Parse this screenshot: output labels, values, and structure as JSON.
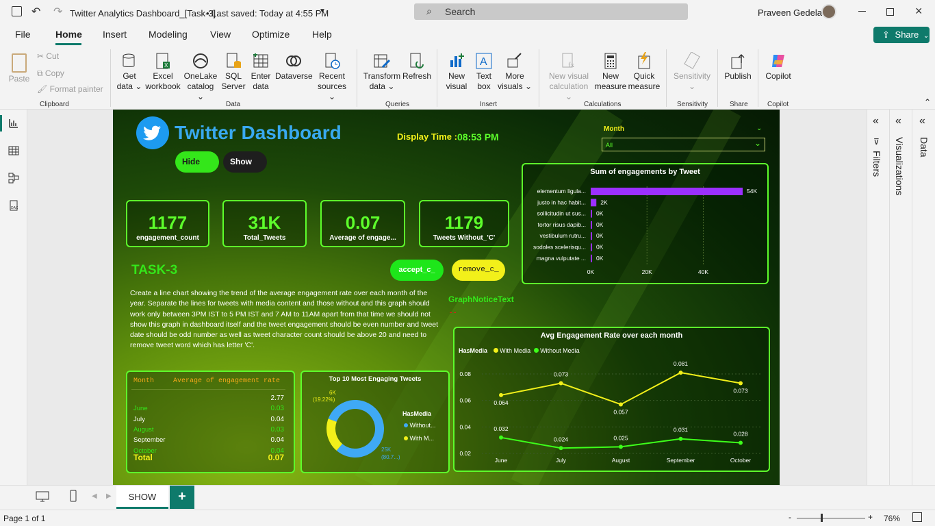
{
  "title_bar": {
    "title": "Twitter Analytics Dashboard_[Task-3]",
    "saved": "• Last saved: Today at 4:55 PM",
    "search_placeholder": "Search",
    "user": "Praveen Gedela"
  },
  "tabs": [
    "File",
    "Home",
    "Insert",
    "Modeling",
    "View",
    "Optimize",
    "Help"
  ],
  "share_label": "Share",
  "ribbon": {
    "paste": "Paste",
    "cut": "Cut",
    "copy": "Copy",
    "format_painter": "Format painter",
    "clipboard": "Clipboard",
    "get_data": [
      "Get",
      "data ⌄"
    ],
    "excel": [
      "Excel",
      "workbook"
    ],
    "onelake": [
      "OneLake",
      "catalog ⌄"
    ],
    "sql": [
      "SQL",
      "Server"
    ],
    "enter": [
      "Enter",
      "data"
    ],
    "dataverse": "Dataverse",
    "recent": [
      "Recent",
      "sources ⌄"
    ],
    "data_group": "Data",
    "transform": [
      "Transform",
      "data ⌄"
    ],
    "refresh": "Refresh",
    "queries": "Queries",
    "new_visual": [
      "New",
      "visual"
    ],
    "text_box": [
      "Text",
      "box"
    ],
    "more_visuals": [
      "More",
      "visuals ⌄"
    ],
    "insert": "Insert",
    "new_visual_calc": [
      "New visual",
      "calculation ⌄"
    ],
    "new_measure": [
      "New",
      "measure"
    ],
    "quick_measure": [
      "Quick",
      "measure"
    ],
    "calculations": "Calculations",
    "sensitivity": [
      "Sensitivity",
      "⌄"
    ],
    "sensitivity_group": "Sensitivity",
    "publish": "Publish",
    "share_group": "Share",
    "copilot": "Copilot",
    "copilot_group": "Copilot"
  },
  "dashboard": {
    "title": "Twitter Dashboard",
    "display_time_label": "Display Time :",
    "display_time": "08:53 PM",
    "hide": "Hide",
    "show": "Show",
    "month_label": "Month",
    "month_value": "All",
    "kpis": [
      {
        "value": "1177",
        "label": "engagement_count"
      },
      {
        "value": "31K",
        "label": "Total_Tweets"
      },
      {
        "value": "0.07",
        "label": "Average of engage..."
      },
      {
        "value": "1179",
        "label": "Tweets Without_'C'"
      }
    ],
    "task": "TASK-3",
    "accept": "accept_c_",
    "remove": "remove_c_",
    "description": "Create a line chart showing the trend of the average engagement rate over each month of the year. Separate the lines for tweets with media content and those without and this graph should work only between 3PM IST to 5 PM IST and 7 AM to 11AM apart from that time we should not show this graph in dashboard itself and the tweet engagement should be even number and tweet date should be odd number as well as tweet character count should be above 20 and need to remove tweet word which has letter 'C'.",
    "notice": "GraphNoticeText",
    "notice_dash": "- -",
    "table": {
      "headers": [
        "Month",
        "Average of engagement rate"
      ],
      "rows": [
        [
          "",
          "2.77"
        ],
        [
          "June",
          "0.03"
        ],
        [
          "July",
          "0.04"
        ],
        [
          "August",
          "0.03"
        ],
        [
          "September",
          "0.04"
        ],
        [
          "October",
          "0.04"
        ]
      ],
      "total_label": "Total",
      "total_value": "0.07"
    },
    "donut": {
      "title": "Top 10 Most Engaging Tweets",
      "legend_title": "HasMedia",
      "legend": [
        "Without...",
        "With M..."
      ],
      "label_small": "6K",
      "label_small_pct": "(19.22%)",
      "label_big": "25K",
      "label_big_pct": "(80.7...)"
    }
  },
  "chart_data": [
    {
      "type": "bar",
      "title": "Sum of engagements by Tweet",
      "orientation": "horizontal",
      "categories": [
        "elementum ligula...",
        "justo in hac habit...",
        "sollicitudin ut sus...",
        "tortor risus dapib...",
        "vestibulum rutru...",
        "sodales scelerisqu...",
        "magna vulputate ..."
      ],
      "values": [
        54000,
        2000,
        0,
        0,
        0,
        0,
        0
      ],
      "data_labels": [
        "54K",
        "2K",
        "0K",
        "0K",
        "0K",
        "0K",
        "0K"
      ],
      "xticks": [
        "0K",
        "20K",
        "40K"
      ],
      "xlim": [
        0,
        54000
      ],
      "color": "#9b30ff"
    },
    {
      "type": "line",
      "title": "Avg Engagement Rate over each month",
      "legend_title": "HasMedia",
      "categories": [
        "June",
        "July",
        "August",
        "September",
        "October"
      ],
      "series": [
        {
          "name": "With Media",
          "values": [
            0.064,
            0.073,
            0.057,
            0.081,
            0.073
          ],
          "color": "#f2f01a"
        },
        {
          "name": "Without Media",
          "values": [
            0.032,
            0.024,
            0.025,
            0.031,
            0.028
          ],
          "color": "#3dff1a"
        }
      ],
      "yticks": [
        "0.08",
        "0.06",
        "0.04",
        "0.02"
      ],
      "ylim": [
        0.02,
        0.08
      ]
    },
    {
      "type": "pie",
      "title": "Top 10 Most Engaging Tweets",
      "legend_title": "HasMedia",
      "series": [
        {
          "name": "Without...",
          "value": 25000,
          "color": "#3fa9f5"
        },
        {
          "name": "With M...",
          "value": 6000,
          "color": "#f2f01a"
        }
      ]
    }
  ],
  "pages": {
    "tab": "SHOW"
  },
  "status": {
    "page": "Page 1 of 1",
    "zoom": "76%"
  },
  "panes": {
    "filters": "Filters",
    "visualizations": "Visualizations",
    "data": "Data"
  }
}
